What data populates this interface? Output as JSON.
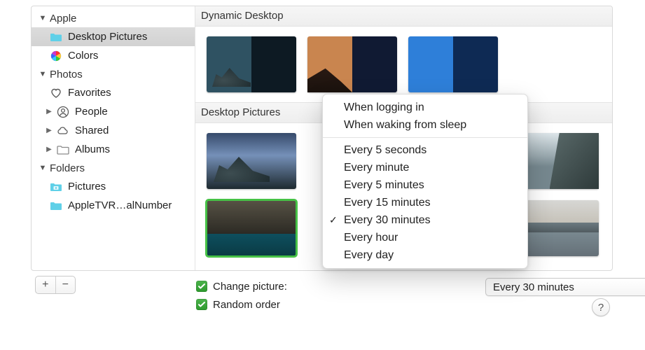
{
  "sidebar": {
    "groups": [
      {
        "label": "Apple",
        "items": [
          {
            "label": "Desktop Pictures",
            "icon": "folder-cyan",
            "selected": true
          },
          {
            "label": "Colors",
            "icon": "color-wheel"
          }
        ]
      },
      {
        "label": "Photos",
        "items": [
          {
            "label": "Favorites",
            "icon": "heart"
          },
          {
            "label": "People",
            "icon": "person",
            "disclosure": true
          },
          {
            "label": "Shared",
            "icon": "cloud",
            "disclosure": true
          },
          {
            "label": "Albums",
            "icon": "folder-gray",
            "disclosure": true
          }
        ]
      },
      {
        "label": "Folders",
        "items": [
          {
            "label": "Pictures",
            "icon": "folder-pictures"
          },
          {
            "label": "AppleTVR…alNumber",
            "icon": "folder-cyan"
          }
        ]
      }
    ]
  },
  "sections": {
    "dynamic": {
      "title": "Dynamic Desktop"
    },
    "desktop": {
      "title": "Desktop Pictures"
    }
  },
  "controls": {
    "change_picture_label": "Change picture:",
    "random_order_label": "Random order",
    "change_picture_checked": true,
    "random_order_checked": true,
    "interval_selected": "Every 30 minutes"
  },
  "menu": {
    "items": [
      {
        "label": "When logging in"
      },
      {
        "label": "When waking from sleep"
      },
      {
        "sep": true
      },
      {
        "label": "Every 5 seconds"
      },
      {
        "label": "Every minute"
      },
      {
        "label": "Every 5 minutes"
      },
      {
        "label": "Every 15 minutes"
      },
      {
        "label": "Every 30 minutes",
        "checked": true
      },
      {
        "label": "Every hour"
      },
      {
        "label": "Every day"
      }
    ]
  },
  "help_glyph": "?",
  "plus_glyph": "+",
  "minus_glyph": "−"
}
